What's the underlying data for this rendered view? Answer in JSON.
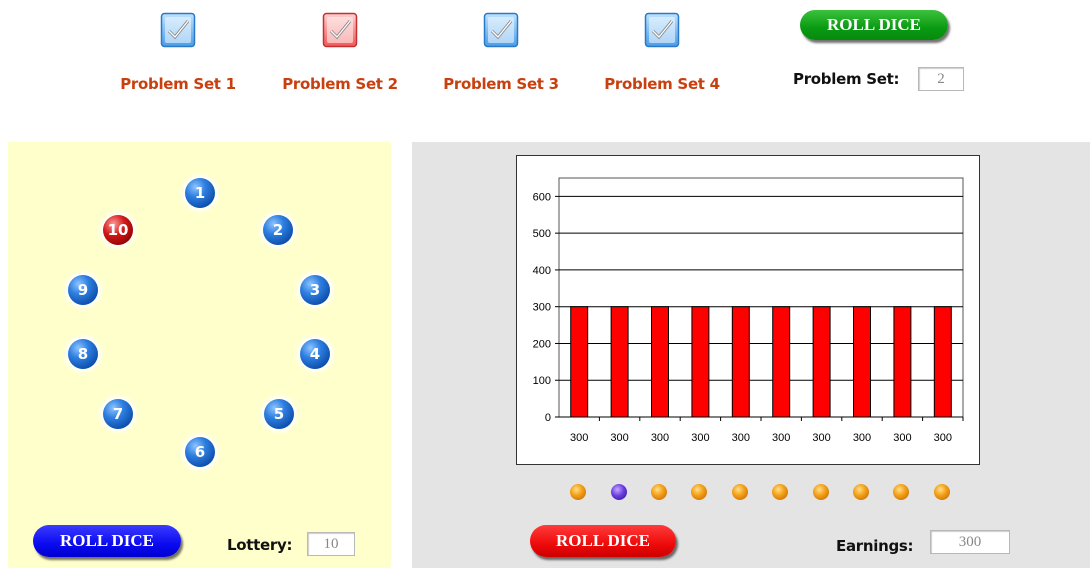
{
  "problem_sets": [
    {
      "label": "Problem Set 1",
      "icon": "check-icon",
      "color": "blue"
    },
    {
      "label": "Problem Set 2",
      "icon": "check-icon",
      "color": "red"
    },
    {
      "label": "Problem Set 3",
      "icon": "check-icon",
      "color": "blue"
    },
    {
      "label": "Problem Set 4",
      "icon": "check-icon",
      "color": "blue"
    }
  ],
  "top": {
    "roll_dice_label": "ROLL DICE",
    "problem_set_label": "Problem Set:",
    "problem_set_value": "2"
  },
  "lottery": {
    "balls": [
      "1",
      "2",
      "3",
      "4",
      "5",
      "6",
      "7",
      "8",
      "9",
      "10"
    ],
    "selected": "10",
    "roll_dice_label": "ROLL DICE",
    "lottery_label": "Lottery:",
    "lottery_value": "10"
  },
  "earnings": {
    "roll_dice_label": "ROLL DICE",
    "earnings_label": "Earnings:",
    "earnings_value": "300",
    "dots": [
      "orange",
      "purple",
      "orange",
      "orange",
      "orange",
      "orange",
      "orange",
      "orange",
      "orange",
      "orange"
    ]
  },
  "chart_data": {
    "type": "bar",
    "categories": [
      "300",
      "300",
      "300",
      "300",
      "300",
      "300",
      "300",
      "300",
      "300",
      "300"
    ],
    "values": [
      300,
      300,
      300,
      300,
      300,
      300,
      300,
      300,
      300,
      300
    ],
    "yticks": [
      0,
      100,
      200,
      300,
      400,
      500,
      600
    ],
    "ylim": [
      0,
      650
    ],
    "bar_color": "#ff0000",
    "grid": true
  }
}
